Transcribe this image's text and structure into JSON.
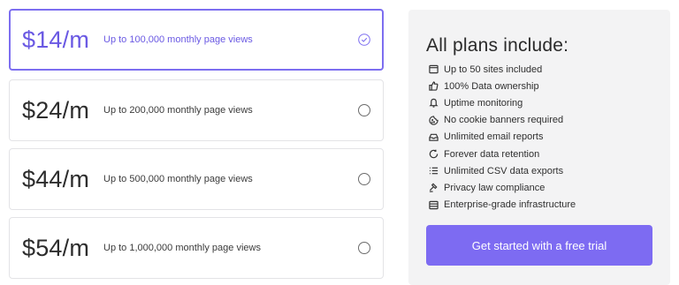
{
  "plans": [
    {
      "price": "$14/m",
      "description": "Up to 100,000 monthly page views",
      "selected": true
    },
    {
      "price": "$24/m",
      "description": "Up to 200,000 monthly page views",
      "selected": false
    },
    {
      "price": "$44/m",
      "description": "Up to 500,000 monthly page views",
      "selected": false
    },
    {
      "price": "$54/m",
      "description": "Up to 1,000,000 monthly page views",
      "selected": false
    }
  ],
  "panel": {
    "heading": "All plans include:",
    "features": [
      {
        "icon": "browser-window-icon",
        "label": "Up to 50 sites included"
      },
      {
        "icon": "thumbs-up-icon",
        "label": "100% Data ownership"
      },
      {
        "icon": "bell-icon",
        "label": "Uptime monitoring"
      },
      {
        "icon": "cookie-icon",
        "label": "No cookie banners required"
      },
      {
        "icon": "inbox-icon",
        "label": "Unlimited email reports"
      },
      {
        "icon": "refresh-icon",
        "label": "Forever data retention"
      },
      {
        "icon": "list-icon",
        "label": "Unlimited CSV data exports"
      },
      {
        "icon": "gavel-icon",
        "label": "Privacy law compliance"
      },
      {
        "icon": "server-icon",
        "label": "Enterprise-grade infrastructure"
      }
    ],
    "cta_label": "Get started with a free trial"
  },
  "colors": {
    "accent": "#7d6bf2",
    "accent_text": "#6a59e3",
    "panel_bg": "#f3f3f4"
  }
}
